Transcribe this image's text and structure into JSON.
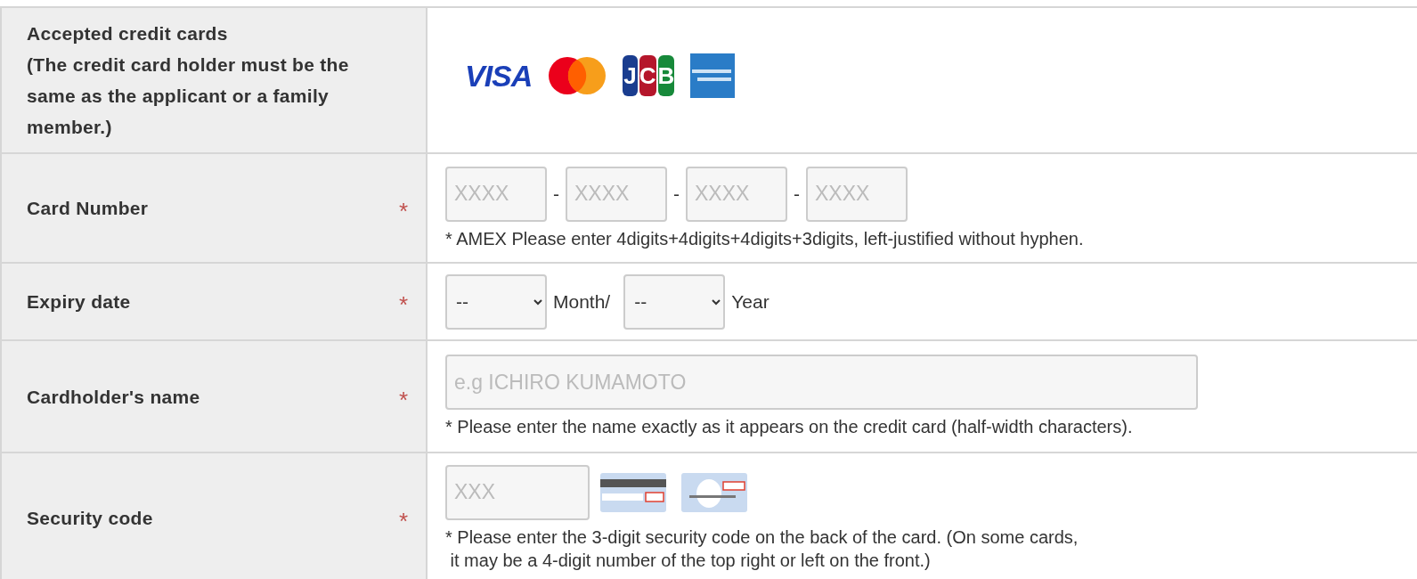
{
  "rows": [
    {
      "kind": "cards",
      "label": "Accepted credit cards\n(The credit card holder must be the same as the applicant or a family member.)",
      "required": false,
      "cards": [
        {
          "kind": "visa",
          "text": "VISA"
        },
        {
          "kind": "mastercard"
        },
        {
          "kind": "jcb",
          "text": "JCB"
        },
        {
          "kind": "amex"
        }
      ]
    },
    {
      "kind": "card_number",
      "label": "Card Number",
      "required": true,
      "fields": [
        {
          "placeholder": "XXXX"
        },
        {
          "placeholder": "XXXX"
        },
        {
          "placeholder": "XXXX"
        },
        {
          "placeholder": "XXXX"
        }
      ],
      "separator": "-",
      "note": [
        "* AMEX Please enter 4digits+4digits+4digits+3digits, left-justified without hyphen."
      ]
    },
    {
      "kind": "expiry",
      "label": "Expiry date",
      "required": true,
      "selects": [
        {
          "value": "--",
          "unit": "Month/"
        },
        {
          "value": "--",
          "unit": "Year"
        }
      ]
    },
    {
      "kind": "name",
      "label": "Cardholder's name",
      "required": true,
      "placeholder": "e.g ICHIRO KUMAMOTO",
      "note": [
        "* Please enter the name exactly as it appears on the credit card (half-width characters)."
      ]
    },
    {
      "kind": "security",
      "label": "Security code",
      "required": true,
      "placeholder": "XXX",
      "note": [
        "* Please enter the 3-digit security code on the back of the card. (On some cards,",
        " it may be a 4-digit number of the top right or left on the front.)"
      ]
    }
  ],
  "required_mark": "*"
}
